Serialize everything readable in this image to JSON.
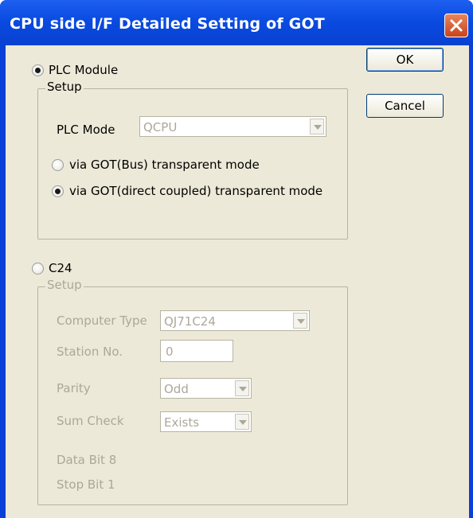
{
  "window": {
    "title": "CPU side I/F Detailed Setting of GOT"
  },
  "buttons": {
    "ok": "OK",
    "cancel": "Cancel"
  },
  "plc_module": {
    "label": "PLC Module",
    "selected": true,
    "group_label": "Setup",
    "plc_mode_label": "PLC Mode",
    "plc_mode_value": "QCPU",
    "options": [
      {
        "label": "via GOT(Bus) transparent mode",
        "selected": false
      },
      {
        "label": "via GOT(direct coupled) transparent mode",
        "selected": true
      }
    ]
  },
  "c24": {
    "label": "C24",
    "selected": false,
    "group_label": "Setup",
    "computer_type_label": "Computer Type",
    "computer_type_value": "QJ71C24",
    "station_no_label": "Station No.",
    "station_no_value": "0",
    "parity_label": "Parity",
    "parity_value": "Odd",
    "sum_check_label": "Sum Check",
    "sum_check_value": "Exists",
    "data_bit_text": "Data Bit  8",
    "stop_bit_text": "Stop Bit  1"
  },
  "colors": {
    "titlebar": "#0a4ae0",
    "dialog_bg": "#ece9d8",
    "disabled_text": "#aca899",
    "close": "#c9431e"
  },
  "icons": {
    "close": "close-icon"
  }
}
